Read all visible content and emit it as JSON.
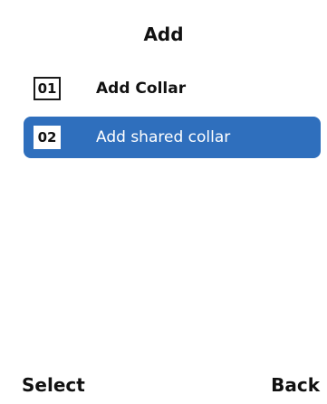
{
  "header": {
    "title": "Add"
  },
  "menu": {
    "items": [
      {
        "number": "01",
        "label": "Add Collar",
        "selected": false
      },
      {
        "number": "02",
        "label": "Add shared collar",
        "selected": true
      }
    ]
  },
  "softkeys": {
    "left": "Select",
    "right": "Back"
  },
  "colors": {
    "selection_background": "#2f6fbd",
    "background": "#ffffff",
    "text": "#111111"
  }
}
